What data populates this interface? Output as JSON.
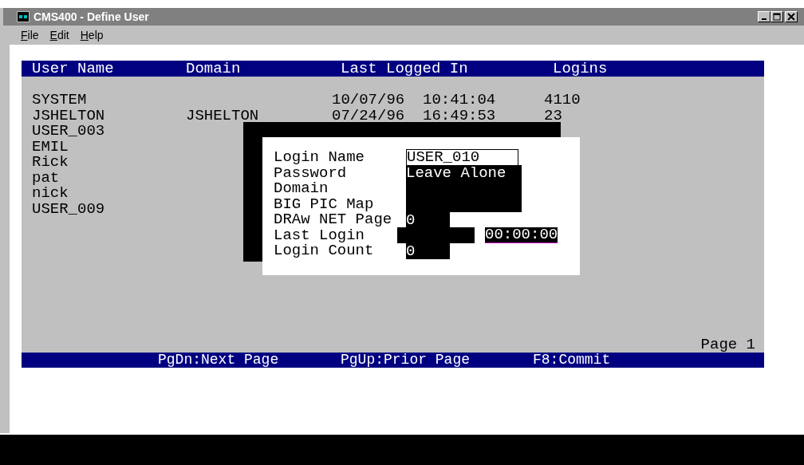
{
  "window": {
    "title": "CMS400 - Define User"
  },
  "menu": [
    {
      "label": "File"
    },
    {
      "label": "Edit"
    },
    {
      "label": "Help"
    }
  ],
  "table": {
    "columns": [
      "User Name",
      "Domain",
      "Last Logged In",
      "Logins"
    ],
    "rows": [
      {
        "user_name": "SYSTEM",
        "last_logged_in": "10/07/96  10:41:04",
        "logins": "4110"
      },
      {
        "user_name": "JSHELTON",
        "domain": "JSHELTON",
        "last_logged_in": "07/24/96  16:49:53",
        "logins": "23"
      },
      {
        "user_name": "USER_003"
      },
      {
        "user_name": "EMIL"
      },
      {
        "user_name": "Rick"
      },
      {
        "user_name": "pat"
      },
      {
        "user_name": "nick"
      },
      {
        "user_name": "USER_009"
      }
    ]
  },
  "dialog": {
    "fields": [
      {
        "label": "Login Name",
        "kind": "name",
        "value": "USER_010"
      },
      {
        "label": "Password",
        "kind": "text",
        "value": "Leave Alone"
      },
      {
        "label": "Domain",
        "kind": "text"
      },
      {
        "label": "BIG PIC Map",
        "kind": "text"
      },
      {
        "label": "DRAw NET Page",
        "kind": "number",
        "value": "0"
      },
      {
        "label": "Last Login",
        "kind": "datetime",
        "time": "00:00:00"
      },
      {
        "label": "Login Count",
        "kind": "number",
        "value": "0"
      }
    ]
  },
  "page_label": "Page 1",
  "key_hints": [
    "PgDn:Next Page",
    "PgUp:Prior Page",
    "F8:Commit"
  ]
}
